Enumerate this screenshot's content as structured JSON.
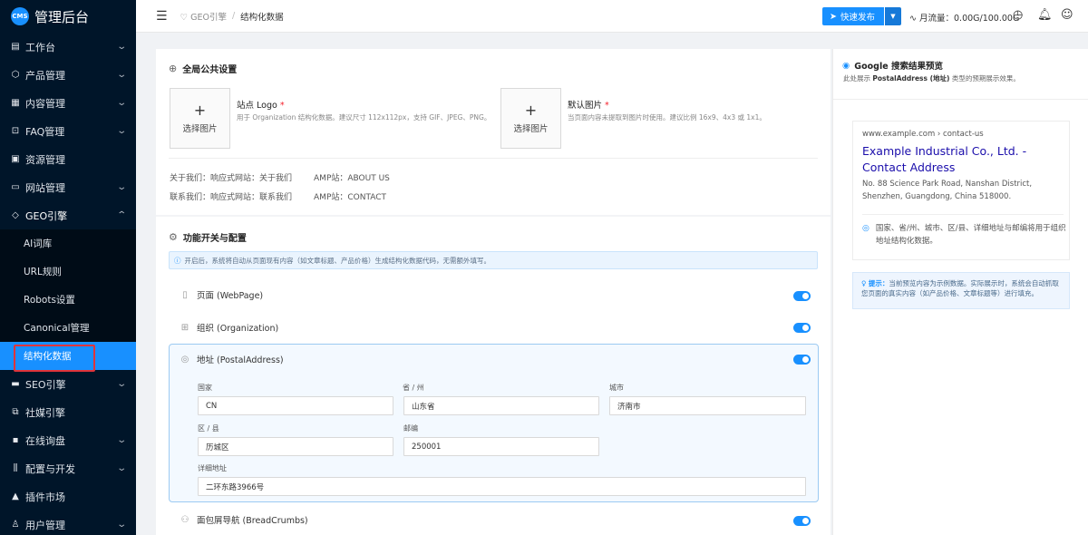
{
  "app": {
    "logo_badge": "CMS",
    "title": "管理后台"
  },
  "sidebar": {
    "items": [
      {
        "label": "工作台",
        "icon": "dashboard-icon"
      },
      {
        "label": "产品管理",
        "icon": "cube-icon"
      },
      {
        "label": "内容管理",
        "icon": "document-icon"
      },
      {
        "label": "FAQ管理",
        "icon": "faq-icon"
      },
      {
        "label": "资源管理",
        "icon": "folder-icon"
      },
      {
        "label": "网站管理",
        "icon": "browser-icon"
      },
      {
        "label": "GEO引擎",
        "icon": "diamond-icon"
      },
      {
        "label": "SEO引擎",
        "icon": "monitor-icon"
      },
      {
        "label": "社媒引擎",
        "icon": "share-icon"
      },
      {
        "label": "在线询盘",
        "icon": "chat-icon"
      },
      {
        "label": "配置与开发",
        "icon": "sliders-icon"
      },
      {
        "label": "插件市场",
        "icon": "store-icon"
      },
      {
        "label": "用户管理",
        "icon": "user-icon"
      }
    ],
    "geo_subitems": [
      "AI词库",
      "URL规则",
      "Robots设置",
      "Canonical管理",
      "结构化数据"
    ]
  },
  "header": {
    "breadcrumb": [
      "GEO引擎",
      "结构化数据"
    ],
    "quick_publish": "快速发布",
    "traffic": "月流量：0.00G/100.00G"
  },
  "global": {
    "title": "全局公共设置",
    "select_image": "选择图片",
    "logo_label": "站点 Logo",
    "logo_hint": "用于 Organization 结构化数据。建议尺寸 112x112px，支持 GIF、JPEG、PNG。",
    "default_label": "默认图片",
    "default_hint": "当页面内容未提取到图片时使用。建议比例 16x9、4x3 或 1x1。",
    "required_mark": "*",
    "about_responsive": "关于我们：响应式网站：关于我们",
    "about_amp": "AMP站：ABOUT US",
    "contact_responsive": "联系我们：响应式网站：联系我们",
    "contact_amp": "AMP站：CONTACT"
  },
  "features": {
    "title": "功能开关与配置",
    "notice": "开启后，系统将自动从页面现有内容（如文章标题、产品价格）生成结构化数据代码，无需额外填写。",
    "webpage": "页面 (WebPage)",
    "organization": "组织 (Organization)",
    "postal": "地址 (PostalAddress)",
    "breadcrumbs": "面包屑导航 (BreadCrumbs)",
    "toggles": {
      "webpage": true,
      "organization": true,
      "postal": true,
      "breadcrumbs": true
    }
  },
  "address": {
    "country_label": "国家",
    "country": "CN",
    "province_label": "省 / 州",
    "province": "山东省",
    "city_label": "城市",
    "city": "济南市",
    "district_label": "区 / 县",
    "district": "历城区",
    "postcode_label": "邮编",
    "postcode": "250001",
    "detail_label": "详细地址",
    "detail": "二环东路3966号"
  },
  "preview": {
    "title": "Google 搜索结果预览",
    "desc_prefix": "此处展示 ",
    "desc_bold": "PostalAddress (地址)",
    "desc_suffix": " 类型的预期展示效果。",
    "url": "www.example.com › contact-us",
    "result_title": "Example Industrial Co., Ltd. - Contact Address",
    "result_addr": "No. 88 Science Park Road, Nanshan District, Shenzhen, Guangdong, China 518000.",
    "result_note": "国家、省/州、城市、区/县、详细地址与邮编将用于组织地址结构化数据。",
    "tip_bold": "提示：",
    "tip_text": "当前预览内容为示例数据。实际展示时，系统会自动抓取您页面的真实内容（如产品价格、文章标题等）进行填充。"
  },
  "colors": {
    "primary": "#1890ff",
    "sidebar_bg": "#001529",
    "required": "#f5222d",
    "highlight_border": "#e0343a"
  }
}
